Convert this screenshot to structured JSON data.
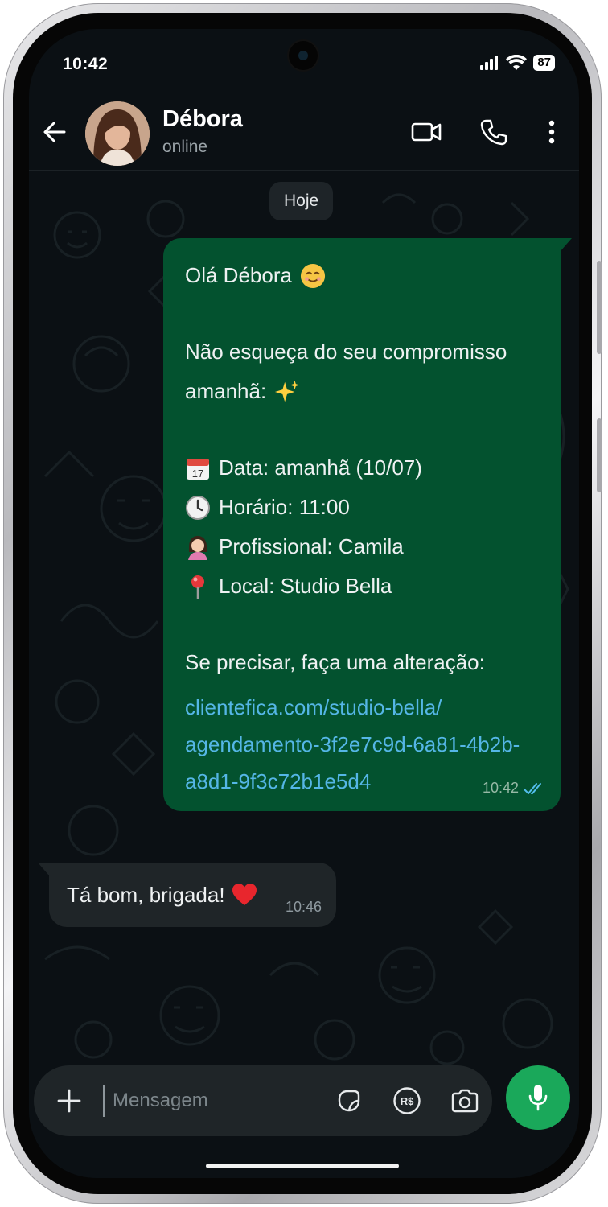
{
  "status_bar": {
    "time": "10:42",
    "battery": "87",
    "icons": [
      "signal-icon",
      "wifi-icon",
      "battery-icon"
    ]
  },
  "header": {
    "contact_name": "Débora",
    "contact_status": "online",
    "icons": [
      "back-arrow-icon",
      "video-call-icon",
      "phone-call-icon",
      "more-options-icon"
    ]
  },
  "chat": {
    "date_chip": "Hoje",
    "outgoing": {
      "greeting": "Olá Débora",
      "line1": "Não esqueça do seu compromisso",
      "line2": "amanhã:",
      "date": "Data: amanhã (10/07)",
      "time_slot": "Horário: 11:00",
      "professional": "Profissional: Camila",
      "location": "Local: Studio Bella",
      "change_prompt": "Se precisar, faça uma alteração:",
      "link_lines": [
        "clientefica.com/studio-bella/",
        "agendamento-3f2e7c9d-6a81-4b2b-",
        "a8d1-9f3c72b1e5d4"
      ],
      "sent_time": "10:42",
      "emojis": [
        "smile-emoji",
        "sparkles-emoji",
        "calendar-emoji",
        "clock-emoji",
        "woman-emoji",
        "pin-emoji"
      ]
    },
    "incoming": {
      "text": "Tá bom, brigada!",
      "time": "10:46",
      "emoji": "red-heart-emoji"
    }
  },
  "composer": {
    "placeholder": "Mensagem",
    "icons": [
      "plus-icon",
      "sticker-icon",
      "payment-icon",
      "camera-icon",
      "mic-icon"
    ]
  },
  "colors": {
    "background": "#0b1014",
    "outgoing_bubble": "#03522f",
    "incoming_bubble": "#1f2528",
    "link": "#55b6e6",
    "mic_button": "#1aa85a",
    "read_ticks": "#53bdeb"
  }
}
